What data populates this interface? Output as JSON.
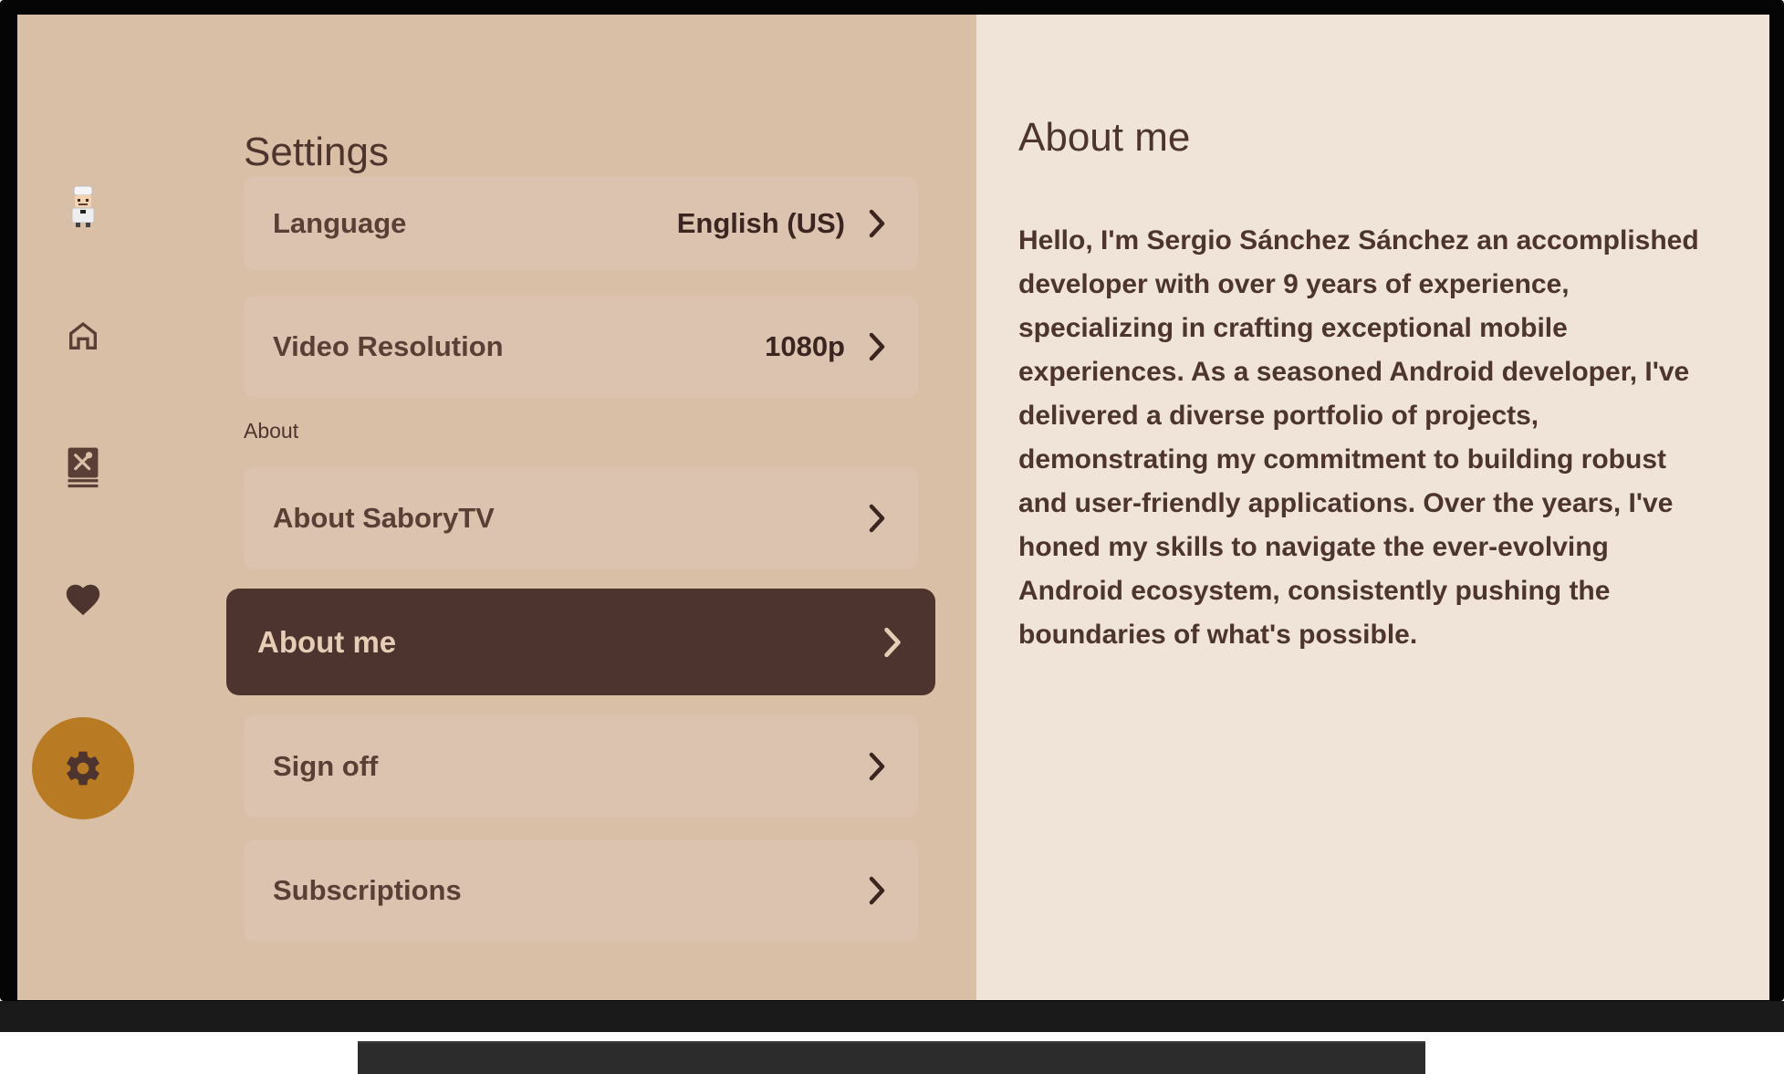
{
  "nav": {
    "items": [
      {
        "icon": "chef-avatar-icon"
      },
      {
        "icon": "home-icon"
      },
      {
        "icon": "recipe-book-icon"
      },
      {
        "icon": "heart-icon"
      },
      {
        "icon": "gear-icon",
        "active": true
      }
    ]
  },
  "settings": {
    "title": "Settings",
    "rows": {
      "language": {
        "label": "Language",
        "value": "English (US)"
      },
      "video": {
        "label": "Video Resolution",
        "value": "1080p"
      }
    },
    "section_about": "About",
    "about_rows": {
      "about_app": {
        "label": "About SaboryTV"
      },
      "about_me": {
        "label": "About me"
      },
      "sign_off": {
        "label": "Sign off"
      },
      "subscriptions": {
        "label": "Subscriptions"
      }
    }
  },
  "detail": {
    "title": "About me",
    "body": "Hello, I'm Sergio Sánchez Sánchez an accomplished developer with over 9 years of experience, specializing in crafting exceptional mobile experiences. As a seasoned Android developer, I've delivered a diverse portfolio of projects, demonstrating my commitment to building robust and user-friendly applications. Over the years, I've honed my skills to navigate the ever-evolving Android ecosystem, consistently pushing the boundaries of what's possible."
  },
  "colors": {
    "left_bg": "#d9bfa6",
    "right_bg": "#f0e4d8",
    "row_bg": "#dcc3b0",
    "focused_row_bg": "#4e342e",
    "accent": "#b87a22",
    "text": "#4e342e"
  }
}
